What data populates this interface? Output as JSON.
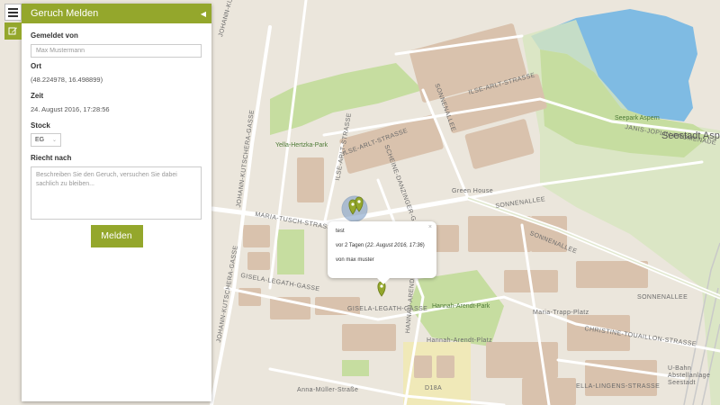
{
  "panel": {
    "title": "Geruch Melden",
    "reported_by_label": "Gemeldet von",
    "reported_by_placeholder": "Max Mustermann",
    "location_label": "Ort",
    "location_value": "(48.224978, 16.498899)",
    "time_label": "Zeit",
    "time_value": "24. August 2016, 17:28:56",
    "floor_label": "Stock",
    "floor_value": "EG",
    "smell_label": "Riecht nach",
    "smell_placeholder": "Beschreiben Sie den Geruch, versuchen Sie dabei sachlich zu bleiben...",
    "submit_label": "Melden"
  },
  "popup": {
    "title": "test",
    "time_prefix": "vor 2 Tagen (",
    "time_detail": "22. August 2016, 17:36",
    "time_suffix": ")",
    "author": "von max muster"
  },
  "map": {
    "labels": {
      "johann_kutschera_1": "JOHANN-KUTSCHERA-GASSE",
      "johann_kutschera_2": "JOHANN-KUTSCHERA-GASSE",
      "johann_kutschera_3": "JOHANN-KUTSCHERA-GASSE",
      "yella_hertzka": "Yella-Hertzka-Park",
      "ilse_arlt_1": "ILSE-ARLT-STRASSE",
      "ilse_arlt_2": "ILSE-ARLT-STRASSE",
      "ilse_arlt_3": "ILSE-ARLT-STRASSE",
      "sonnenallee_1": "SONNENALLEE",
      "sonnenallee_2": "SONNENALLEE",
      "sonnenallee_3": "SONNENALLEE",
      "sonnenallee_4": "SONNENALLEE",
      "scheine_danzinger": "SCHEINE-DANZINGER-GASSE",
      "green_house": "Green House",
      "seepark_aspern": "Seepark Aspern",
      "janis_joplin": "JANIS-JOPLIN-PROMENADE",
      "seestadt_aspern": "Seestadt Aspern",
      "maria_tusch": "MARIA-TUSCH-STRASSE",
      "gisela_legath_1": "GISELA-LEGATH-GASSE",
      "gisela_legath_2": "GISELA-LEGATH-GASSE",
      "hannah_arendt_gasse": "HANNAH-ARENDT-GASSE",
      "hannah_arendt_park": "Hannah-Arendt-Park",
      "hannah_arendt_platz": "Hannah-Arendt-Platz",
      "maria_trapp": "Maria-Trapp-Platz",
      "christine_touaillon": "CHRISTINE-TOUAILLON-STRASSE",
      "ella_lingens": "ELLA-LINGENS-STRASSE",
      "anna_muller_strasse": "Anna-Müller-Straße",
      "d18a": "D18A",
      "ubahn": "U-Bahn Abstellanlage Seestadt"
    }
  },
  "colors": {
    "accent": "#94a72c",
    "map_bg": "#ebe6dc",
    "park": "#c6dda0",
    "water": "#7fbbe3",
    "building": "#d9c2ad",
    "road": "#ffffff"
  }
}
